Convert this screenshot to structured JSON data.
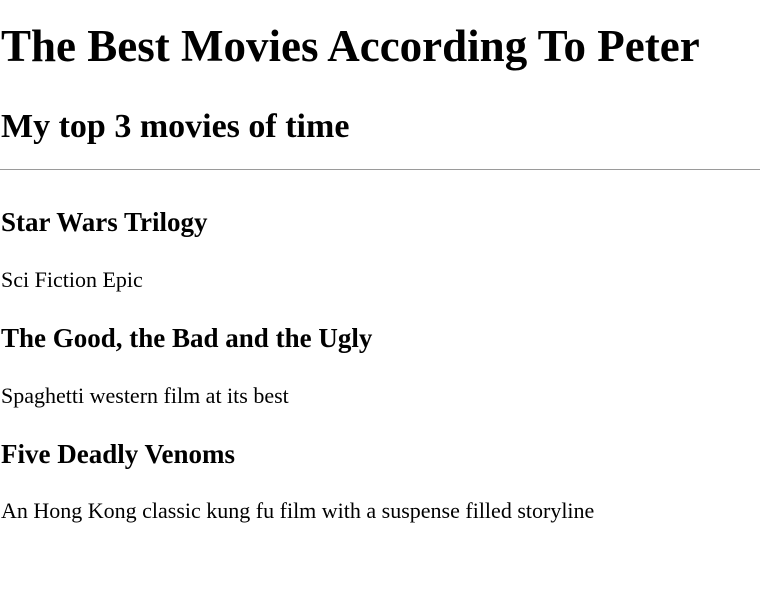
{
  "page": {
    "title": "The Best Movies According To Peter",
    "subtitle": "My top 3 movies of time"
  },
  "movies": [
    {
      "title": "Star Wars Trilogy",
      "description": "Sci Fiction Epic"
    },
    {
      "title": "The Good, the Bad and the Ugly",
      "description": "Spaghetti western film at its best"
    },
    {
      "title": "Five Deadly Venoms",
      "description": "An Hong Kong classic kung fu film with a suspense filled storyline"
    }
  ]
}
